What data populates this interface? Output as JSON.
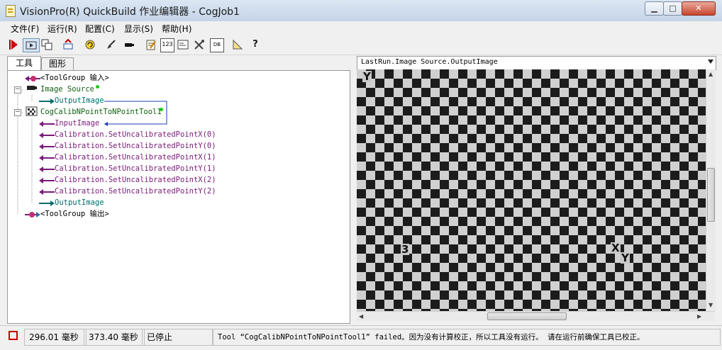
{
  "window": {
    "title": "VisionPro(R) QuickBuild 作业编辑器 - CogJob1",
    "buttons": {
      "minimize": "▁",
      "maximize": "□",
      "close": "✕"
    }
  },
  "menu": [
    "文件(F)",
    "运行(R)",
    "配置(C)",
    "显示(S)",
    "帮助(H)"
  ],
  "toolbar": {
    "icons": [
      "run-icon",
      "run-continuous-icon",
      "copy-image-icon",
      "reset-icon",
      "refresh-icon",
      "brush-icon",
      "camera-icon",
      "edit-icon",
      "number-icon",
      "terminal-icon",
      "tools-icon",
      "db-icon",
      "ruler-icon",
      "help-icon"
    ],
    "labels": {
      "number": "123",
      "db": "DB"
    }
  },
  "tabs": [
    "工具",
    "图形"
  ],
  "tree": [
    {
      "text": "<ToolGroup 输入>",
      "kind": "group"
    },
    {
      "text": "Image Source",
      "kind": "tool"
    },
    {
      "text": "OutputImage",
      "kind": "output"
    },
    {
      "text": "CogCalibNPointToNPointTool1",
      "kind": "tool"
    },
    {
      "text": "InputImage",
      "kind": "input"
    },
    {
      "text": "Calibration.SetUncalibratedPointX(0)",
      "kind": "input"
    },
    {
      "text": "Calibration.SetUncalibratedPointY(0)",
      "kind": "input"
    },
    {
      "text": "Calibration.SetUncalibratedPointX(1)",
      "kind": "input"
    },
    {
      "text": "Calibration.SetUncalibratedPointY(1)",
      "kind": "input"
    },
    {
      "text": "Calibration.SetUncalibratedPointX(2)",
      "kind": "input"
    },
    {
      "text": "Calibration.SetUncalibratedPointY(2)",
      "kind": "input"
    },
    {
      "text": "OutputImage",
      "kind": "output"
    },
    {
      "text": "<ToolGroup 输出>",
      "kind": "group"
    }
  ],
  "image_view": {
    "title": "LastRun.Image Source.OutputImage",
    "marks": [
      "Y",
      "3",
      "X",
      "Y"
    ]
  },
  "status": {
    "x": "296.01 毫秒",
    "y": "373.40 毫秒",
    "state": "已停止",
    "message": "Tool “CogCalibNPointToNPointTool1” failed。因为没有计算校正，所以工具没有运行。 请在运行前确保工具已校正。"
  },
  "colors": {
    "accent_purple": "#7a1a7a",
    "accent_teal": "#006d6d",
    "status_green": "#1cc81c"
  }
}
